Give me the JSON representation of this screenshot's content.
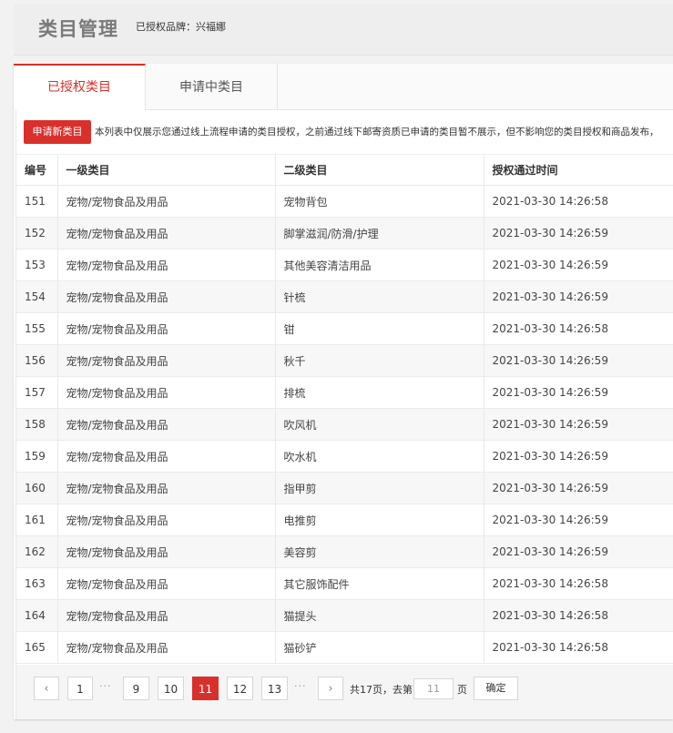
{
  "header": {
    "title": "类目管理",
    "brand_label": "已授权品牌：",
    "brand_name": "兴福娜"
  },
  "tabs": [
    {
      "label": "已授权类目",
      "active": true
    },
    {
      "label": "申请中类目",
      "active": false
    }
  ],
  "toolbar": {
    "apply_button": "申请新类目",
    "notice": "本列表中仅展示您通过线上流程申请的类目授权，之前通过线下邮寄资质已申请的类目暂不展示，但不影响您的类目授权和商品发布，"
  },
  "table": {
    "columns": [
      "编号",
      "一级类目",
      "二级类目",
      "授权通过时间"
    ],
    "rows": [
      [
        "151",
        "宠物/宠物食品及用品",
        "宠物背包",
        "2021-03-30 14:26:58"
      ],
      [
        "152",
        "宠物/宠物食品及用品",
        "脚掌滋润/防滑/护理",
        "2021-03-30 14:26:59"
      ],
      [
        "153",
        "宠物/宠物食品及用品",
        "其他美容清洁用品",
        "2021-03-30 14:26:59"
      ],
      [
        "154",
        "宠物/宠物食品及用品",
        "针梳",
        "2021-03-30 14:26:59"
      ],
      [
        "155",
        "宠物/宠物食品及用品",
        "钳",
        "2021-03-30 14:26:58"
      ],
      [
        "156",
        "宠物/宠物食品及用品",
        "秋千",
        "2021-03-30 14:26:59"
      ],
      [
        "157",
        "宠物/宠物食品及用品",
        "排梳",
        "2021-03-30 14:26:59"
      ],
      [
        "158",
        "宠物/宠物食品及用品",
        "吹风机",
        "2021-03-30 14:26:59"
      ],
      [
        "159",
        "宠物/宠物食品及用品",
        "吹水机",
        "2021-03-30 14:26:59"
      ],
      [
        "160",
        "宠物/宠物食品及用品",
        "指甲剪",
        "2021-03-30 14:26:59"
      ],
      [
        "161",
        "宠物/宠物食品及用品",
        "电推剪",
        "2021-03-30 14:26:59"
      ],
      [
        "162",
        "宠物/宠物食品及用品",
        "美容剪",
        "2021-03-30 14:26:59"
      ],
      [
        "163",
        "宠物/宠物食品及用品",
        "其它服饰配件",
        "2021-03-30 14:26:58"
      ],
      [
        "164",
        "宠物/宠物食品及用品",
        "猫提头",
        "2021-03-30 14:26:58"
      ],
      [
        "165",
        "宠物/宠物食品及用品",
        "猫砂铲",
        "2021-03-30 14:26:58"
      ]
    ]
  },
  "pagination": {
    "prev_icon": "chevron-left-icon",
    "next_icon": "chevron-right-icon",
    "prev_glyph": "‹",
    "next_glyph": "›",
    "first": "1",
    "ellipsis": "···",
    "pages": [
      "9",
      "10",
      "11",
      "12",
      "13"
    ],
    "current": "11",
    "total_text": "共17页，去第",
    "goto_value": "11",
    "goto_suffix": "页",
    "confirm": "确定"
  },
  "colors": {
    "accent": "#d9302c",
    "tab_active_text": "#d0342c"
  }
}
